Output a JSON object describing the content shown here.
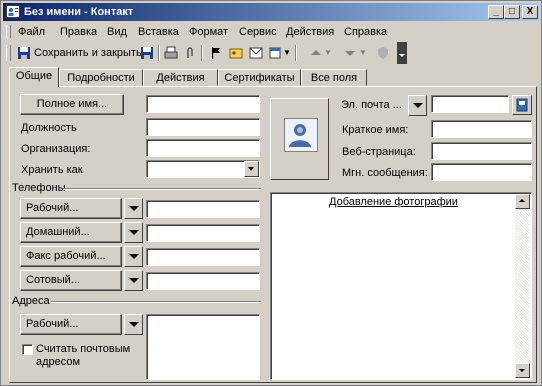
{
  "window": {
    "title": "Без имени - Контакт",
    "controls": {
      "minimize": "_",
      "maximize": "□",
      "close": "X"
    }
  },
  "menu": [
    "Файл",
    "Правка",
    "Вид",
    "Вставка",
    "Формат",
    "Сервис",
    "Действия",
    "Справка"
  ],
  "toolbar": {
    "save_close": "Сохранить и закрыть"
  },
  "tabs": [
    {
      "label": "Общие",
      "active": true
    },
    {
      "label": "Подробности",
      "active": false
    },
    {
      "label": "Действия",
      "active": false
    },
    {
      "label": "Сертификаты",
      "active": false
    },
    {
      "label": "Все поля",
      "active": false
    }
  ],
  "form": {
    "full_name_button": "Полное имя...",
    "job_title_label": "Должность",
    "company_label": "Организация:",
    "file_as_label": "Хранить как",
    "phones_section": "Телефоны",
    "phones": [
      "Рабочий...",
      "Домашний...",
      "Факс рабочий...",
      "Сотовый..."
    ],
    "address_section": "Адреса",
    "address_button": "Рабочий...",
    "mailing_address_checkbox": "Считать почтовым адресом",
    "email_label": "Эл. почта ...",
    "display_name_label": "Краткое имя:",
    "web_label": "Веб-страница:",
    "im_label": "Мгн. сообщения:",
    "add_photo_link": "Добавление фотографии"
  },
  "colors": {
    "title_gradient_start": "#0a246a",
    "title_gradient_end": "#a6caf0",
    "face": "#d4d0c8",
    "link": "#000080"
  }
}
